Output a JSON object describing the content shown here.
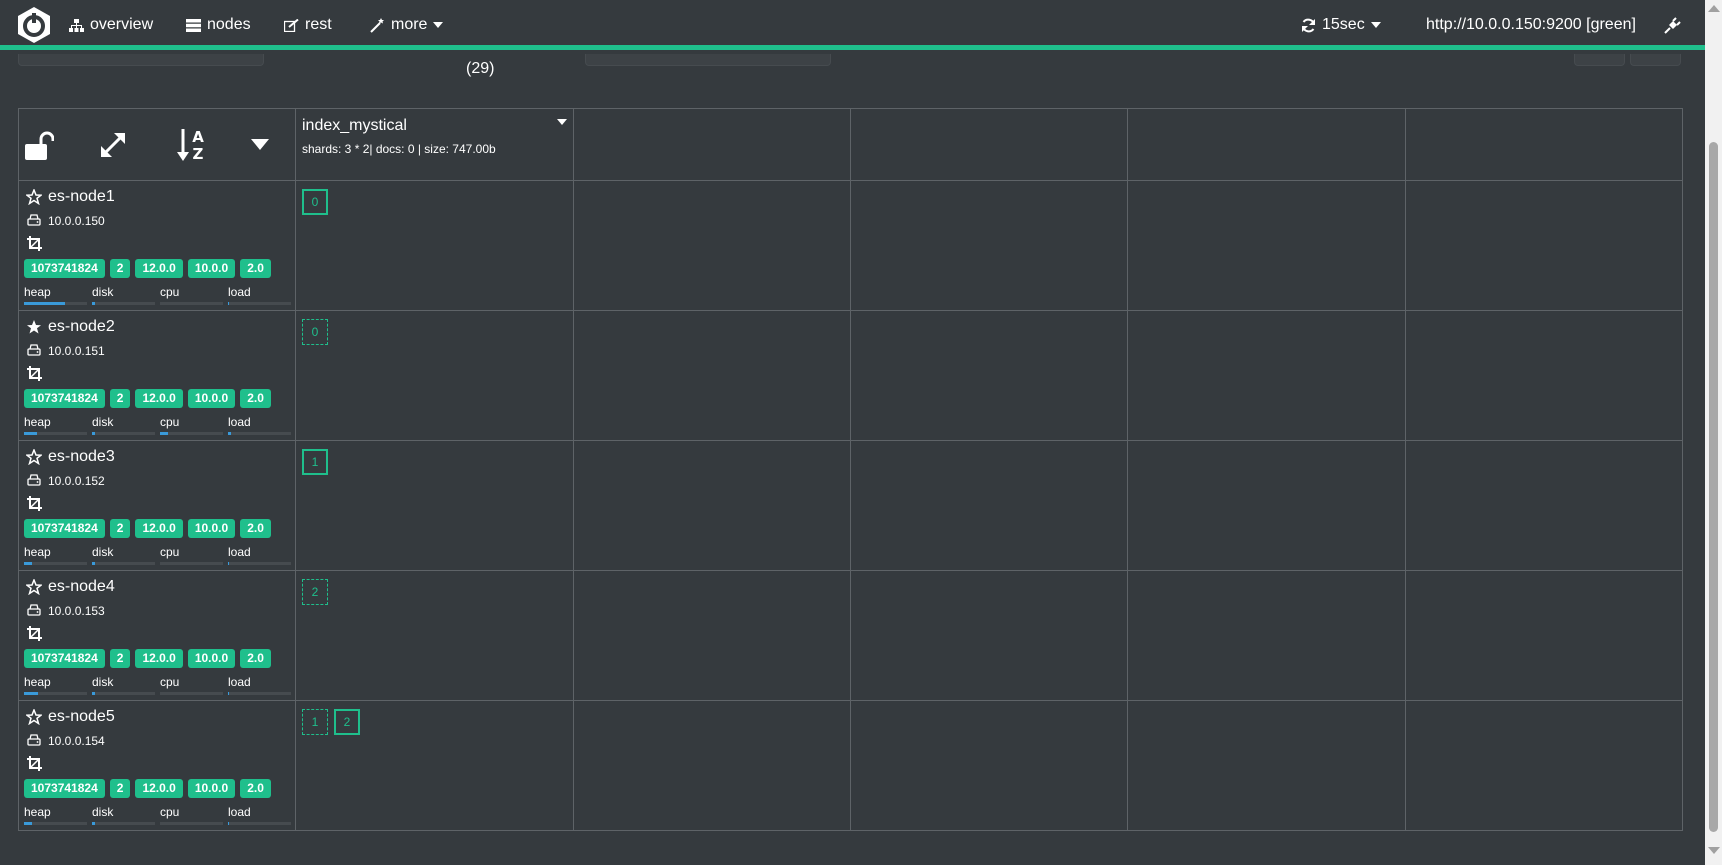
{
  "nav": {
    "overview": "overview",
    "nodes": "nodes",
    "rest": "rest",
    "more": "more",
    "refresh": "15sec",
    "cluster": "http://10.0.0.150:9200 [green]"
  },
  "filters": {
    "count": "(29)"
  },
  "index": {
    "name": "index_mystical",
    "meta": "shards: 3 * 2| docs: 0 | size: 747.00b"
  },
  "nodes": [
    {
      "name": "es-node1",
      "ip": "10.0.0.150",
      "master": false,
      "badges": [
        "1073741824",
        "2",
        "12.0.0",
        "10.0.0",
        "2.0"
      ],
      "metrics": {
        "heap": 0.65,
        "disk": 0.05,
        "cpu": 0.0,
        "load": 0.02
      },
      "shards": [
        {
          "id": "0",
          "primary": true
        }
      ]
    },
    {
      "name": "es-node2",
      "ip": "10.0.0.151",
      "master": true,
      "badges": [
        "1073741824",
        "2",
        "12.0.0",
        "10.0.0",
        "2.0"
      ],
      "metrics": {
        "heap": 0.2,
        "disk": 0.05,
        "cpu": 0.12,
        "load": 0.05
      },
      "shards": [
        {
          "id": "0",
          "primary": false
        }
      ]
    },
    {
      "name": "es-node3",
      "ip": "10.0.0.152",
      "master": false,
      "badges": [
        "1073741824",
        "2",
        "12.0.0",
        "10.0.0",
        "2.0"
      ],
      "metrics": {
        "heap": 0.12,
        "disk": 0.05,
        "cpu": 0.0,
        "load": 0.02
      },
      "shards": [
        {
          "id": "1",
          "primary": true
        }
      ]
    },
    {
      "name": "es-node4",
      "ip": "10.0.0.153",
      "master": false,
      "badges": [
        "1073741824",
        "2",
        "12.0.0",
        "10.0.0",
        "2.0"
      ],
      "metrics": {
        "heap": 0.22,
        "disk": 0.05,
        "cpu": 0.0,
        "load": 0.02
      },
      "shards": [
        {
          "id": "2",
          "primary": false
        }
      ]
    },
    {
      "name": "es-node5",
      "ip": "10.0.0.154",
      "master": false,
      "badges": [
        "1073741824",
        "2",
        "12.0.0",
        "10.0.0",
        "2.0"
      ],
      "metrics": {
        "heap": 0.12,
        "disk": 0.05,
        "cpu": 0.0,
        "load": 0.02
      },
      "shards": [
        {
          "id": "1",
          "primary": false
        },
        {
          "id": "2",
          "primary": true
        }
      ]
    }
  ],
  "metric_labels": [
    "heap",
    "disk",
    "cpu",
    "load"
  ],
  "colors": {
    "accent": "#1fbf8c",
    "background": "#353a3e",
    "grid_line": "#5e6367",
    "metric_fill": "#3a9ad9"
  }
}
